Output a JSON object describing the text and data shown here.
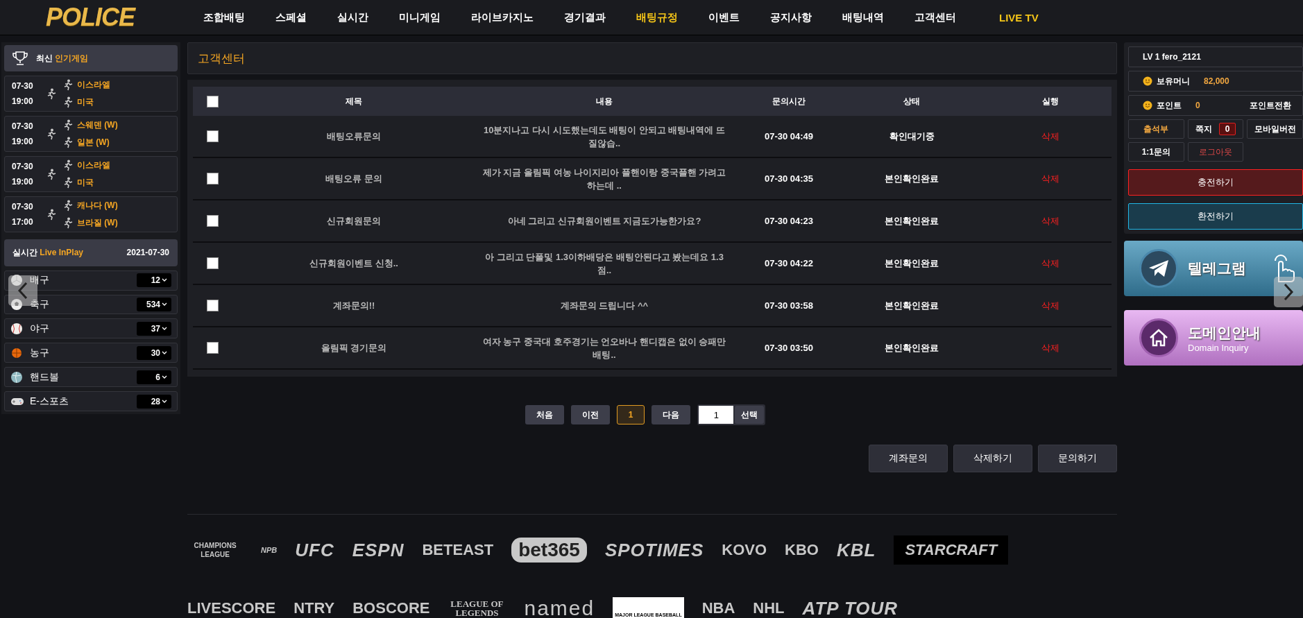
{
  "brand": "POLICE",
  "nav": [
    {
      "label": "조합배팅",
      "kind": "menu",
      "selected": false
    },
    {
      "label": "스페셜",
      "kind": "menu",
      "selected": false
    },
    {
      "label": "실시간",
      "kind": "menu",
      "selected": false
    },
    {
      "label": "미니게임",
      "kind": "menu",
      "selected": false
    },
    {
      "label": "라이브카지노",
      "kind": "menu",
      "selected": false
    },
    {
      "label": "경기결과",
      "kind": "menu",
      "selected": false
    },
    {
      "label": "배팅규정",
      "kind": "menu",
      "selected": true
    },
    {
      "label": "이벤트",
      "kind": "menu",
      "selected": false
    },
    {
      "label": "공지사항",
      "kind": "menu",
      "selected": false
    },
    {
      "label": "배팅내역",
      "kind": "menu",
      "selected": false
    },
    {
      "label": "고객센터",
      "kind": "menu",
      "selected": false
    },
    {
      "label": "LIVE TV",
      "kind": "live",
      "selected": false
    }
  ],
  "sidebar": {
    "popular_title": "최신",
    "popular_highlight": "인기게임",
    "games": [
      {
        "date": "07-30",
        "time": "19:00",
        "home": "이스라엘",
        "away": "미국"
      },
      {
        "date": "07-30",
        "time": "19:00",
        "home": "스웨덴 (W)",
        "away": "일본 (W)"
      },
      {
        "date": "07-30",
        "time": "19:00",
        "home": "이스라엘",
        "away": "미국"
      },
      {
        "date": "07-30",
        "time": "17:00",
        "home": "캐나다 (W)",
        "away": "브라질 (W)"
      }
    ],
    "live_title": "실시간",
    "live_highlight": "Live InPlay",
    "live_date": "2021-07-30",
    "sports": [
      {
        "kind": "volleyball",
        "name": "배구",
        "count": "12"
      },
      {
        "kind": "soccer",
        "name": "축구",
        "count": "534"
      },
      {
        "kind": "baseball",
        "name": "야구",
        "count": "37"
      },
      {
        "kind": "basketball",
        "name": "농구",
        "count": "30"
      },
      {
        "kind": "handball",
        "name": "핸드볼",
        "count": "6"
      },
      {
        "kind": "esports",
        "name": "E-스포츠",
        "count": "28"
      }
    ]
  },
  "main": {
    "title": "고객센터",
    "table": {
      "header_checked": false,
      "columns": [
        "제목",
        "내용",
        "문의시간",
        "상태",
        "실행"
      ],
      "rows": [
        {
          "checked": false,
          "title": "배팅오류문의",
          "content": "10분지나고 다시 시도했는데도 배팅이 안되고 배팅내역에 뜨질않습..",
          "time": "07-30 04:49",
          "status": "확인대기중",
          "action": "삭제"
        },
        {
          "checked": false,
          "title": "배팅오류 문의",
          "content": "제가 지금 올림픽 여농 나이지리아 플핸이랑 중국플핸 가려고하는데 ..",
          "time": "07-30 04:35",
          "status": "본인확인완료",
          "action": "삭제"
        },
        {
          "checked": false,
          "title": "신규회원문의",
          "content": "아네 그리고 신규회원이벤트 지금도가능한가요?",
          "time": "07-30 04:23",
          "status": "본인확인완료",
          "action": "삭제"
        },
        {
          "checked": false,
          "title": "신규회원이벤트 신청..",
          "content": "아 그리고 단폴및 1.3이하배당은 배팅안된다고 봤는데요 1.3점..",
          "time": "07-30 04:22",
          "status": "본인확인완료",
          "action": "삭제"
        },
        {
          "checked": false,
          "title": "계좌문의!!",
          "content": "계좌문의 드립니다 ^^",
          "time": "07-30 03:58",
          "status": "본인확인완료",
          "action": "삭제"
        },
        {
          "checked": false,
          "title": "올림픽 경기문의",
          "content": "여자 농구 중국대 호주경기는 언오바나 핸디캡은 없이 승패만 배팅..",
          "time": "07-30 03:50",
          "status": "본인확인완료",
          "action": "삭제"
        }
      ]
    },
    "pagination": {
      "first": "처음",
      "prev": "이전",
      "pages": [
        {
          "label": "1",
          "selected": true
        }
      ],
      "next": "다음",
      "page_input": "1",
      "go": "선택"
    },
    "actions": [
      "계좌문의",
      "삭제하기",
      "문의하기"
    ]
  },
  "account": {
    "user": "LV 1 fero_2121",
    "money_label": "보유머니",
    "money": "82,000",
    "point_label": "포인트",
    "point": "0",
    "point_convert": "포인트전환",
    "attendance": "출석부",
    "messages": "쪽지",
    "message_count": "0",
    "mobile": "모바일버전",
    "inquiry": "1:1문의",
    "logout": "로그아웃",
    "deposit": "충전하기",
    "withdraw": "환전하기"
  },
  "banners": [
    {
      "kind": "telegram",
      "title": "텔레그램"
    },
    {
      "kind": "domain",
      "title": "도메인안내",
      "subtitle": "Domain Inquiry"
    }
  ],
  "logo_rows": [
    [
      {
        "kind": "ucl",
        "text": "CHAMPIONS LEAGUE"
      },
      {
        "kind": "small",
        "text": "NPB"
      },
      {
        "kind": "italic",
        "text": "UFC"
      },
      {
        "kind": "italic",
        "text": "ESPN"
      },
      {
        "kind": "plain",
        "text": "BETEAST"
      },
      {
        "kind": "pill",
        "text": "bet365"
      },
      {
        "kind": "italic",
        "text": "SPOTIMES"
      },
      {
        "kind": "plain",
        "text": "KOVO"
      },
      {
        "kind": "plain",
        "text": "KBO"
      },
      {
        "kind": "italic",
        "text": "KBL"
      },
      {
        "kind": "dark",
        "text": "STARCRAFT"
      }
    ],
    [
      {
        "kind": "plain",
        "text": "LIVESCORE"
      },
      {
        "kind": "plain",
        "text": "NTRY"
      },
      {
        "kind": "plain",
        "text": "BOSCORE"
      },
      {
        "kind": "serif",
        "text": "LEAGUE OF LEGENDS"
      },
      {
        "kind": "thin",
        "text": "named"
      },
      {
        "kind": "boxed",
        "text": "MAJOR LEAGUE BASEBALL"
      },
      {
        "kind": "plain",
        "text": "NBA"
      },
      {
        "kind": "plain",
        "text": "NHL"
      },
      {
        "kind": "italic",
        "text": "ATP TOUR"
      }
    ]
  ]
}
